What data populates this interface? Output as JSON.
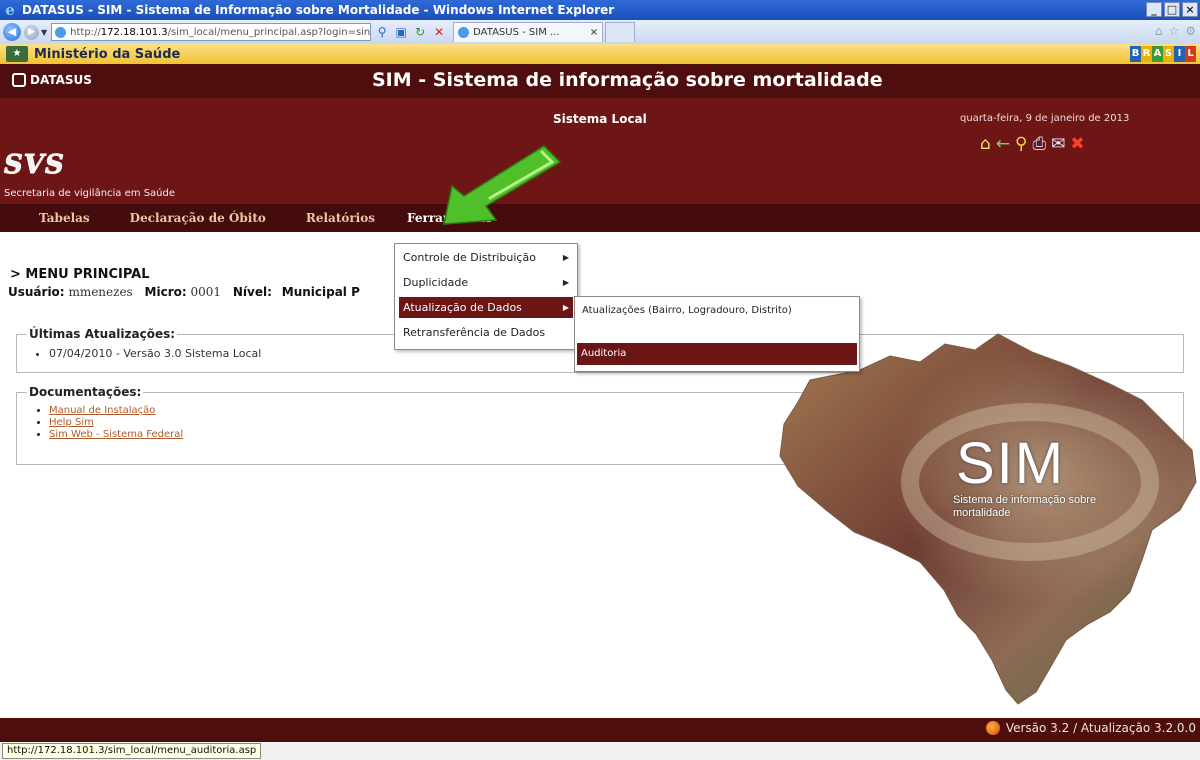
{
  "window": {
    "title": "DATASUS - SIM - Sistema de Informação sobre Mortalidade - Windows Internet Explorer",
    "controls": [
      "_",
      "□",
      "×"
    ]
  },
  "browser": {
    "address_prefix": "http://",
    "address_host": "172.18.101.3",
    "address_path": "/sim_local/menu_principal.asp?login=sin",
    "tab_title": "DATASUS - SIM ...",
    "favorites": {
      "site": "Ministério da Saúde",
      "brand": [
        "B",
        "R",
        "A",
        "S",
        "I",
        "L"
      ]
    },
    "status_url": "http://172.18.101.3/sim_local/menu_auditoria.asp"
  },
  "header": {
    "datasus": "DATASUS",
    "app_title": "SIM - Sistema de informação sobre mortalidade",
    "svs_logo": "SVS",
    "svs_subtitle": "Secretaria de vigilância em Saúde",
    "subsystem": "Sistema Local",
    "date": "quarta-feira, 9 de janeiro de 2013"
  },
  "menu": {
    "items": [
      "Tabelas",
      "Declaração de Óbito",
      "Relatórios",
      "Ferramentas"
    ],
    "active": "Ferramentas"
  },
  "dropdown": {
    "items": [
      {
        "label": "Controle de Distribuição",
        "submenu": true
      },
      {
        "label": "Duplicidade",
        "submenu": true
      },
      {
        "label": "Atualização de Dados",
        "submenu": true,
        "selected": true
      },
      {
        "label": "Retransferência de Dados",
        "submenu": false
      }
    ],
    "submenu": [
      {
        "label": "Atualizações (Bairro, Logradouro, Distrito)"
      },
      {
        "label": "Auditoria",
        "selected": true
      }
    ]
  },
  "main": {
    "title": "> MENU PRINCIPAL",
    "user_label": "Usuário:",
    "user_value": "mmenezes",
    "micro_label": "Micro:",
    "micro_value": "0001",
    "nivel_label": "Nível:",
    "nivel_value": "Municipal P",
    "updates_legend": "Últimas Atualizações:",
    "updates": [
      "07/04/2010 - Versão 3.0 Sistema Local"
    ],
    "docs_legend": "Documentações:",
    "docs": [
      "Manual de Instalação",
      "Help Sim",
      "Sim Web - Sistema Federal"
    ]
  },
  "watermark": {
    "sim": "SIM",
    "subtitle": "Sistema de informação sobre mortalidade"
  },
  "footer": {
    "version": "Versão 3.2 / Atualização 3.2.0.0"
  },
  "colors": {
    "header_dark": "#4f0e0e",
    "header_mid": "#6e1616",
    "menu_highlight": "#6b1515",
    "arrow_green": "#4fbf2a"
  },
  "icons": [
    "ie-logo-icon",
    "back-icon",
    "forward-icon",
    "search-icon",
    "refresh-icon",
    "stop-icon",
    "home-icon",
    "back-arrow-icon",
    "help-icon",
    "print-icon",
    "mail-icon",
    "close-icon",
    "version-icon"
  ]
}
